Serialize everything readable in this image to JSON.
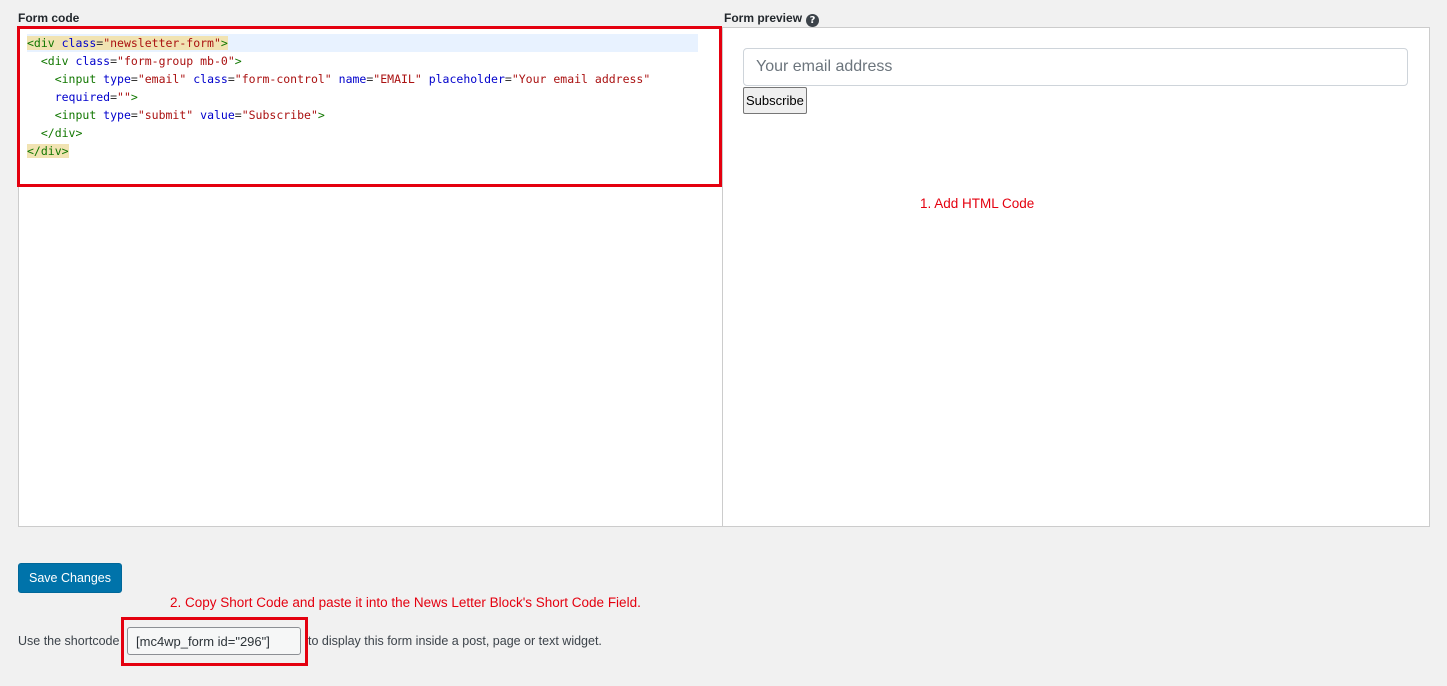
{
  "form_code": {
    "label": "Form code",
    "lines": [
      [
        {
          "t": "tag",
          "v": "<div "
        },
        {
          "t": "attr",
          "v": "class"
        },
        {
          "t": "plain",
          "v": "="
        },
        {
          "t": "str",
          "v": "\"newsletter-form\""
        },
        {
          "t": "tag",
          "v": ">"
        }
      ],
      [
        {
          "t": "plain",
          "v": "  "
        },
        {
          "t": "tag",
          "v": "<div "
        },
        {
          "t": "attr",
          "v": "class"
        },
        {
          "t": "plain",
          "v": "="
        },
        {
          "t": "str",
          "v": "\"form-group mb-0\""
        },
        {
          "t": "tag",
          "v": ">"
        }
      ],
      [
        {
          "t": "plain",
          "v": "    "
        },
        {
          "t": "tag",
          "v": "<input "
        },
        {
          "t": "attr",
          "v": "type"
        },
        {
          "t": "plain",
          "v": "="
        },
        {
          "t": "str",
          "v": "\"email\""
        },
        {
          "t": "plain",
          "v": " "
        },
        {
          "t": "attr",
          "v": "class"
        },
        {
          "t": "plain",
          "v": "="
        },
        {
          "t": "str",
          "v": "\"form-control\""
        },
        {
          "t": "plain",
          "v": " "
        },
        {
          "t": "attr",
          "v": "name"
        },
        {
          "t": "plain",
          "v": "="
        },
        {
          "t": "str",
          "v": "\"EMAIL\""
        },
        {
          "t": "plain",
          "v": " "
        },
        {
          "t": "attr",
          "v": "placeholder"
        },
        {
          "t": "plain",
          "v": "="
        },
        {
          "t": "str",
          "v": "\"Your email address\""
        }
      ],
      [
        {
          "t": "plain",
          "v": "    "
        },
        {
          "t": "attr",
          "v": "required"
        },
        {
          "t": "plain",
          "v": "="
        },
        {
          "t": "str",
          "v": "\"\""
        },
        {
          "t": "tag",
          "v": ">"
        }
      ],
      [
        {
          "t": "plain",
          "v": "    "
        },
        {
          "t": "tag",
          "v": "<input "
        },
        {
          "t": "attr",
          "v": "type"
        },
        {
          "t": "plain",
          "v": "="
        },
        {
          "t": "str",
          "v": "\"submit\""
        },
        {
          "t": "plain",
          "v": " "
        },
        {
          "t": "attr",
          "v": "value"
        },
        {
          "t": "plain",
          "v": "="
        },
        {
          "t": "str",
          "v": "\"Subscribe\""
        },
        {
          "t": "tag",
          "v": ">"
        }
      ],
      [
        {
          "t": "plain",
          "v": "  "
        },
        {
          "t": "tag",
          "v": "</div>"
        }
      ],
      [
        {
          "t": "tag",
          "v": "</div>"
        }
      ]
    ]
  },
  "form_preview": {
    "label": "Form preview",
    "help_icon": "question-circle-icon",
    "email_placeholder": "Your email address",
    "subscribe_label": "Subscribe"
  },
  "annotations": {
    "step1": "1. Add HTML Code",
    "step2": "2. Copy Short Code and paste it into the News Letter Block's Short Code Field."
  },
  "save_label": "Save Changes",
  "shortcode": {
    "before": "Use the shortcode",
    "value": "[mc4wp_form id=\"296\"]",
    "after": "to display this form inside a post, page or text widget."
  },
  "colors": {
    "accent": "#0073aa",
    "annotation_red": "#e4000f"
  }
}
